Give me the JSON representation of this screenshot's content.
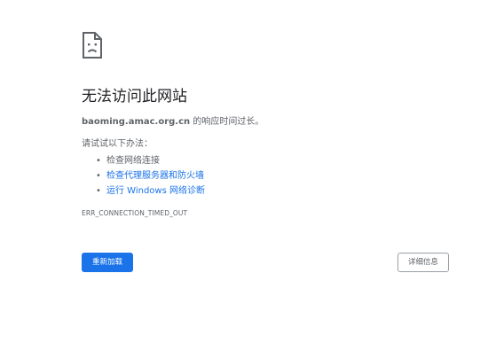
{
  "icon": "sad-page-icon",
  "title": "无法访问此网站",
  "subtitle": {
    "host": "baoming.amac.org.cn",
    "suffix": " 的响应时间过长。"
  },
  "try_heading": "请试试以下办法：",
  "suggestions": [
    {
      "text": "检查网络连接",
      "is_link": false
    },
    {
      "text": "检查代理服务器和防火墙",
      "is_link": true
    },
    {
      "text": "运行 Windows 网络诊断",
      "is_link": true
    }
  ],
  "bullet": "•",
  "error_code": "ERR_CONNECTION_TIMED_OUT",
  "buttons": {
    "reload_label": "重新加载",
    "details_label": "详细信息"
  },
  "colors": {
    "accent": "#1a73e8",
    "text": "#202124",
    "secondary_text": "#5f6368"
  }
}
